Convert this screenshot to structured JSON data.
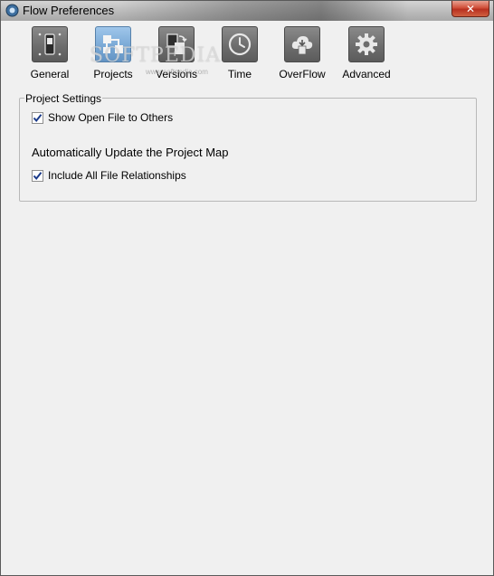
{
  "window": {
    "title": "Flow Preferences",
    "close_glyph": "✕"
  },
  "watermark": {
    "text": "SOFTPEDIA",
    "sub": "www.softpedia.com"
  },
  "toolbar": {
    "tabs": [
      {
        "label": "General",
        "icon": "toggle-switch-icon",
        "active": false
      },
      {
        "label": "Projects",
        "icon": "project-map-icon",
        "active": true
      },
      {
        "label": "Versions",
        "icon": "versions-icon",
        "active": false
      },
      {
        "label": "Time",
        "icon": "clock-icon",
        "active": false
      },
      {
        "label": "OverFlow",
        "icon": "cloud-icon",
        "active": false
      },
      {
        "label": "Advanced",
        "icon": "gear-icon",
        "active": false
      }
    ]
  },
  "project_settings": {
    "legend": "Project Settings",
    "show_open_file": {
      "label": "Show Open File to Others",
      "checked": true
    },
    "update_heading": "Automatically Update the Project Map",
    "include_relationships": {
      "label": "Include All File Relationships",
      "checked": true
    }
  }
}
